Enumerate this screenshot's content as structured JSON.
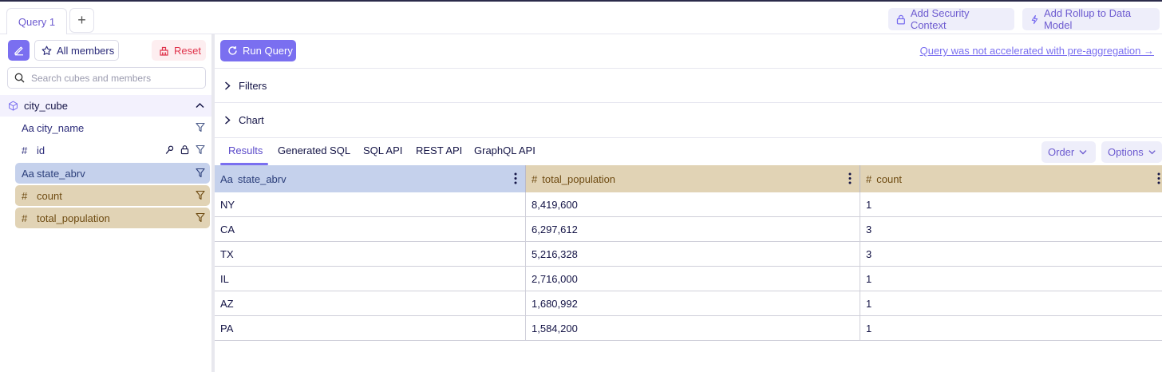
{
  "tabs": {
    "query_tab": "Query 1",
    "add_tab": "+"
  },
  "header": {
    "security_label": "Add Security Context",
    "rollup_label": "Add Rollup to Data Model"
  },
  "sidebar": {
    "all_members_label": "All members",
    "reset_label": "Reset",
    "search_placeholder": "Search cubes and members",
    "cube_name": "city_cube",
    "members": [
      {
        "type": "Aa",
        "name": "city_name"
      },
      {
        "type": "#",
        "name": "id"
      },
      {
        "type": "Aa",
        "name": "state_abrv"
      },
      {
        "type": "#",
        "name": "count"
      },
      {
        "type": "#",
        "name": "total_population"
      }
    ]
  },
  "main": {
    "run_query_label": "Run Query",
    "not_accelerated_link": "Query was not accelerated with pre-aggregation →",
    "filters_label": "Filters",
    "chart_label": "Chart",
    "result_tabs": [
      "Results",
      "Generated SQL",
      "SQL API",
      "REST API",
      "GraphQL API"
    ],
    "order_label": "Order",
    "options_label": "Options"
  },
  "table": {
    "columns": [
      {
        "type": "Aa",
        "name": "state_abrv"
      },
      {
        "type": "#",
        "name": "total_population"
      },
      {
        "type": "#",
        "name": "count"
      }
    ],
    "rows": [
      [
        "NY",
        "8,419,600",
        "1"
      ],
      [
        "CA",
        "6,297,612",
        "3"
      ],
      [
        "TX",
        "5,216,328",
        "3"
      ],
      [
        "IL",
        "2,716,000",
        "1"
      ],
      [
        "AZ",
        "1,680,992",
        "1"
      ],
      [
        "PA",
        "1,584,200",
        "1"
      ]
    ]
  },
  "colors": {
    "accent": "#7a6ff0",
    "dimension_bg": "#c5d1ec",
    "measure_bg": "#e1d3b5",
    "reset_red": "#e0344c"
  }
}
